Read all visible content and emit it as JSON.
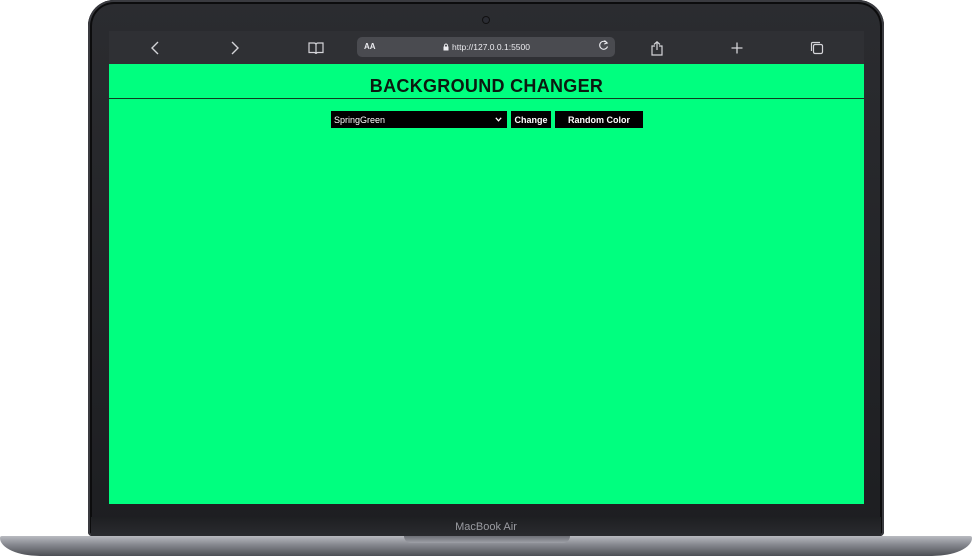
{
  "device": {
    "label": "MacBook Air"
  },
  "browser": {
    "text_size_label": "AA",
    "url": "http://127.0.0.1:5500",
    "icons": {
      "back": "chevron-left-icon",
      "forward": "chevron-right-icon",
      "bookmarks": "book-icon",
      "lock": "lock-icon",
      "reload": "reload-icon",
      "share": "share-icon",
      "new_tab": "plus-icon",
      "tabs": "tabs-icon"
    }
  },
  "page": {
    "title": "BACKGROUND CHANGER",
    "background_color": "#00ff7f",
    "color_select": {
      "selected": "SpringGreen"
    },
    "change_label": "Change",
    "random_label": "Random Color"
  }
}
